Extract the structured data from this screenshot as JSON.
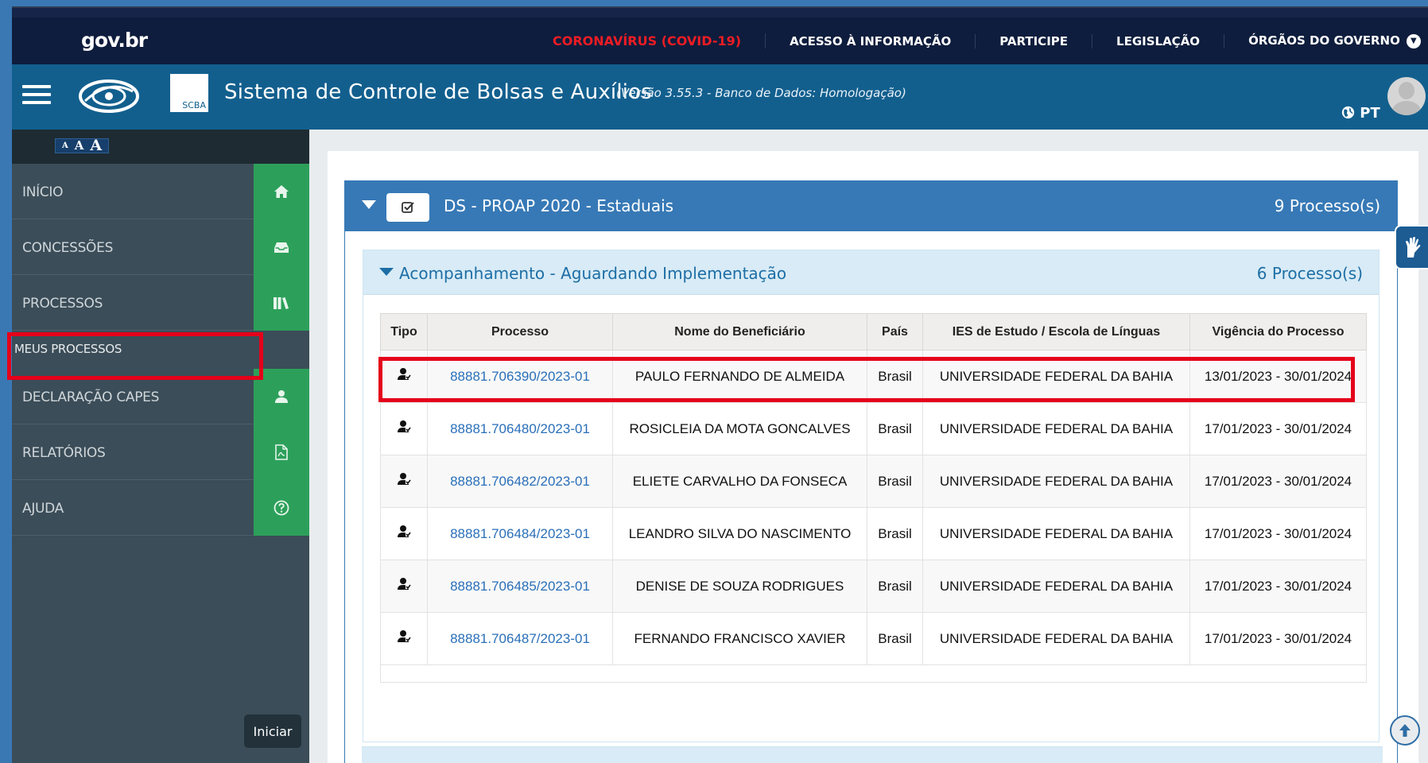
{
  "gov_bar": {
    "logo": "gov.br",
    "links": [
      {
        "label": "CORONAVÍRUS (COVID-19)",
        "highlight": true
      },
      {
        "label": "ACESSO À INFORMAÇÃO"
      },
      {
        "label": "PARTICIPE"
      },
      {
        "label": "LEGISLAÇÃO"
      },
      {
        "label": "ÓRGÃOS DO GOVERNO"
      }
    ]
  },
  "header": {
    "scba_logo": "SCBA",
    "title": "Sistema de Controle de Bolsas e Auxílios",
    "version": "(Versão 3.55.3 - Banco de Dados: Homologação)",
    "language": "PT"
  },
  "font_sizes": [
    "A",
    "A",
    "A"
  ],
  "sidebar": {
    "items": [
      {
        "label": "INÍCIO",
        "icon": "home-icon"
      },
      {
        "label": "CONCESSÕES",
        "icon": "inbox-icon"
      },
      {
        "label": "PROCESSOS",
        "icon": "books-icon"
      },
      {
        "label": "MEUS PROCESSOS",
        "icon": "",
        "active": true
      },
      {
        "label": "DECLARAÇÃO CAPES",
        "icon": "user-icon"
      },
      {
        "label": "RELATÓRIOS",
        "icon": "pdf-icon"
      },
      {
        "label": "AJUDA",
        "icon": "help-icon"
      }
    ],
    "start_button": "Iniciar"
  },
  "panel": {
    "title": "DS - PROAP 2020 - Estaduais",
    "count": "9 Processo(s)",
    "subpanel": {
      "title": "Acompanhamento - Aguardando Implementação",
      "count": "6 Processo(s)",
      "columns": [
        "Tipo",
        "Processo",
        "Nome do Beneficiário",
        "País",
        "IES de Estudo / Escola de Línguas",
        "Vigência do Processo"
      ],
      "rows": [
        {
          "processo": "88881.706390/2023-01",
          "nome": "PAULO FERNANDO DE ALMEIDA",
          "pais": "Brasil",
          "ies": "UNIVERSIDADE FEDERAL DA BAHIA",
          "vigencia": "13/01/2023 - 30/01/2024"
        },
        {
          "processo": "88881.706480/2023-01",
          "nome": "ROSICLEIA DA MOTA GONCALVES",
          "pais": "Brasil",
          "ies": "UNIVERSIDADE FEDERAL DA BAHIA",
          "vigencia": "17/01/2023 - 30/01/2024"
        },
        {
          "processo": "88881.706482/2023-01",
          "nome": "ELIETE CARVALHO DA FONSECA",
          "pais": "Brasil",
          "ies": "UNIVERSIDADE FEDERAL DA BAHIA",
          "vigencia": "17/01/2023 - 30/01/2024"
        },
        {
          "processo": "88881.706484/2023-01",
          "nome": "LEANDRO SILVA DO NASCIMENTO",
          "pais": "Brasil",
          "ies": "UNIVERSIDADE FEDERAL DA BAHIA",
          "vigencia": "17/01/2023 - 30/01/2024"
        },
        {
          "processo": "88881.706485/2023-01",
          "nome": "DENISE DE SOUZA RODRIGUES",
          "pais": "Brasil",
          "ies": "UNIVERSIDADE FEDERAL DA BAHIA",
          "vigencia": "17/01/2023 - 30/01/2024"
        },
        {
          "processo": "88881.706487/2023-01",
          "nome": "FERNANDO FRANCISCO XAVIER",
          "pais": "Brasil",
          "ies": "UNIVERSIDADE FEDERAL DA BAHIA",
          "vigencia": "17/01/2023 - 30/01/2024"
        }
      ]
    }
  },
  "colors": {
    "gov_bar": "#0e1d3d",
    "header": "#125f8e",
    "sidebar": "#3b4d58",
    "sidebar_icons": "#2ca05a",
    "panel_head": "#3779b6",
    "link": "#2a6fb8",
    "highlight_box": "#e5001a",
    "covid_link": "#ee1c24"
  }
}
